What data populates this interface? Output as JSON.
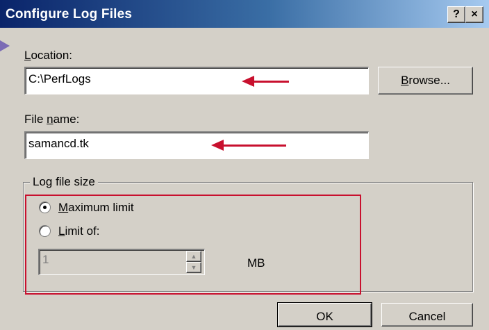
{
  "window": {
    "title": "Configure Log Files",
    "help_glyph": "?",
    "close_glyph": "×"
  },
  "location": {
    "label": "Location:",
    "label_accel": "L",
    "label_rest": "ocation:",
    "value": "C:\\PerfLogs",
    "browse_accel": "B",
    "browse_rest": "rowse..."
  },
  "file_name": {
    "label_pre": "File ",
    "label_accel": "n",
    "label_rest": "ame:",
    "value": "samancd.tk"
  },
  "log_size": {
    "group_label": "Log file size",
    "max_limit_accel": "M",
    "max_limit_rest": "aximum limit",
    "limit_of_accel": "L",
    "limit_of_rest": "imit of:",
    "limit_value": "1",
    "unit": "MB",
    "selected": "Maximum limit"
  },
  "buttons": {
    "ok": "OK",
    "cancel": "Cancel"
  },
  "colors": {
    "annotation": "#c8102e",
    "title_bar": "#0a246a",
    "dialog_bg": "#d4d0c8"
  }
}
